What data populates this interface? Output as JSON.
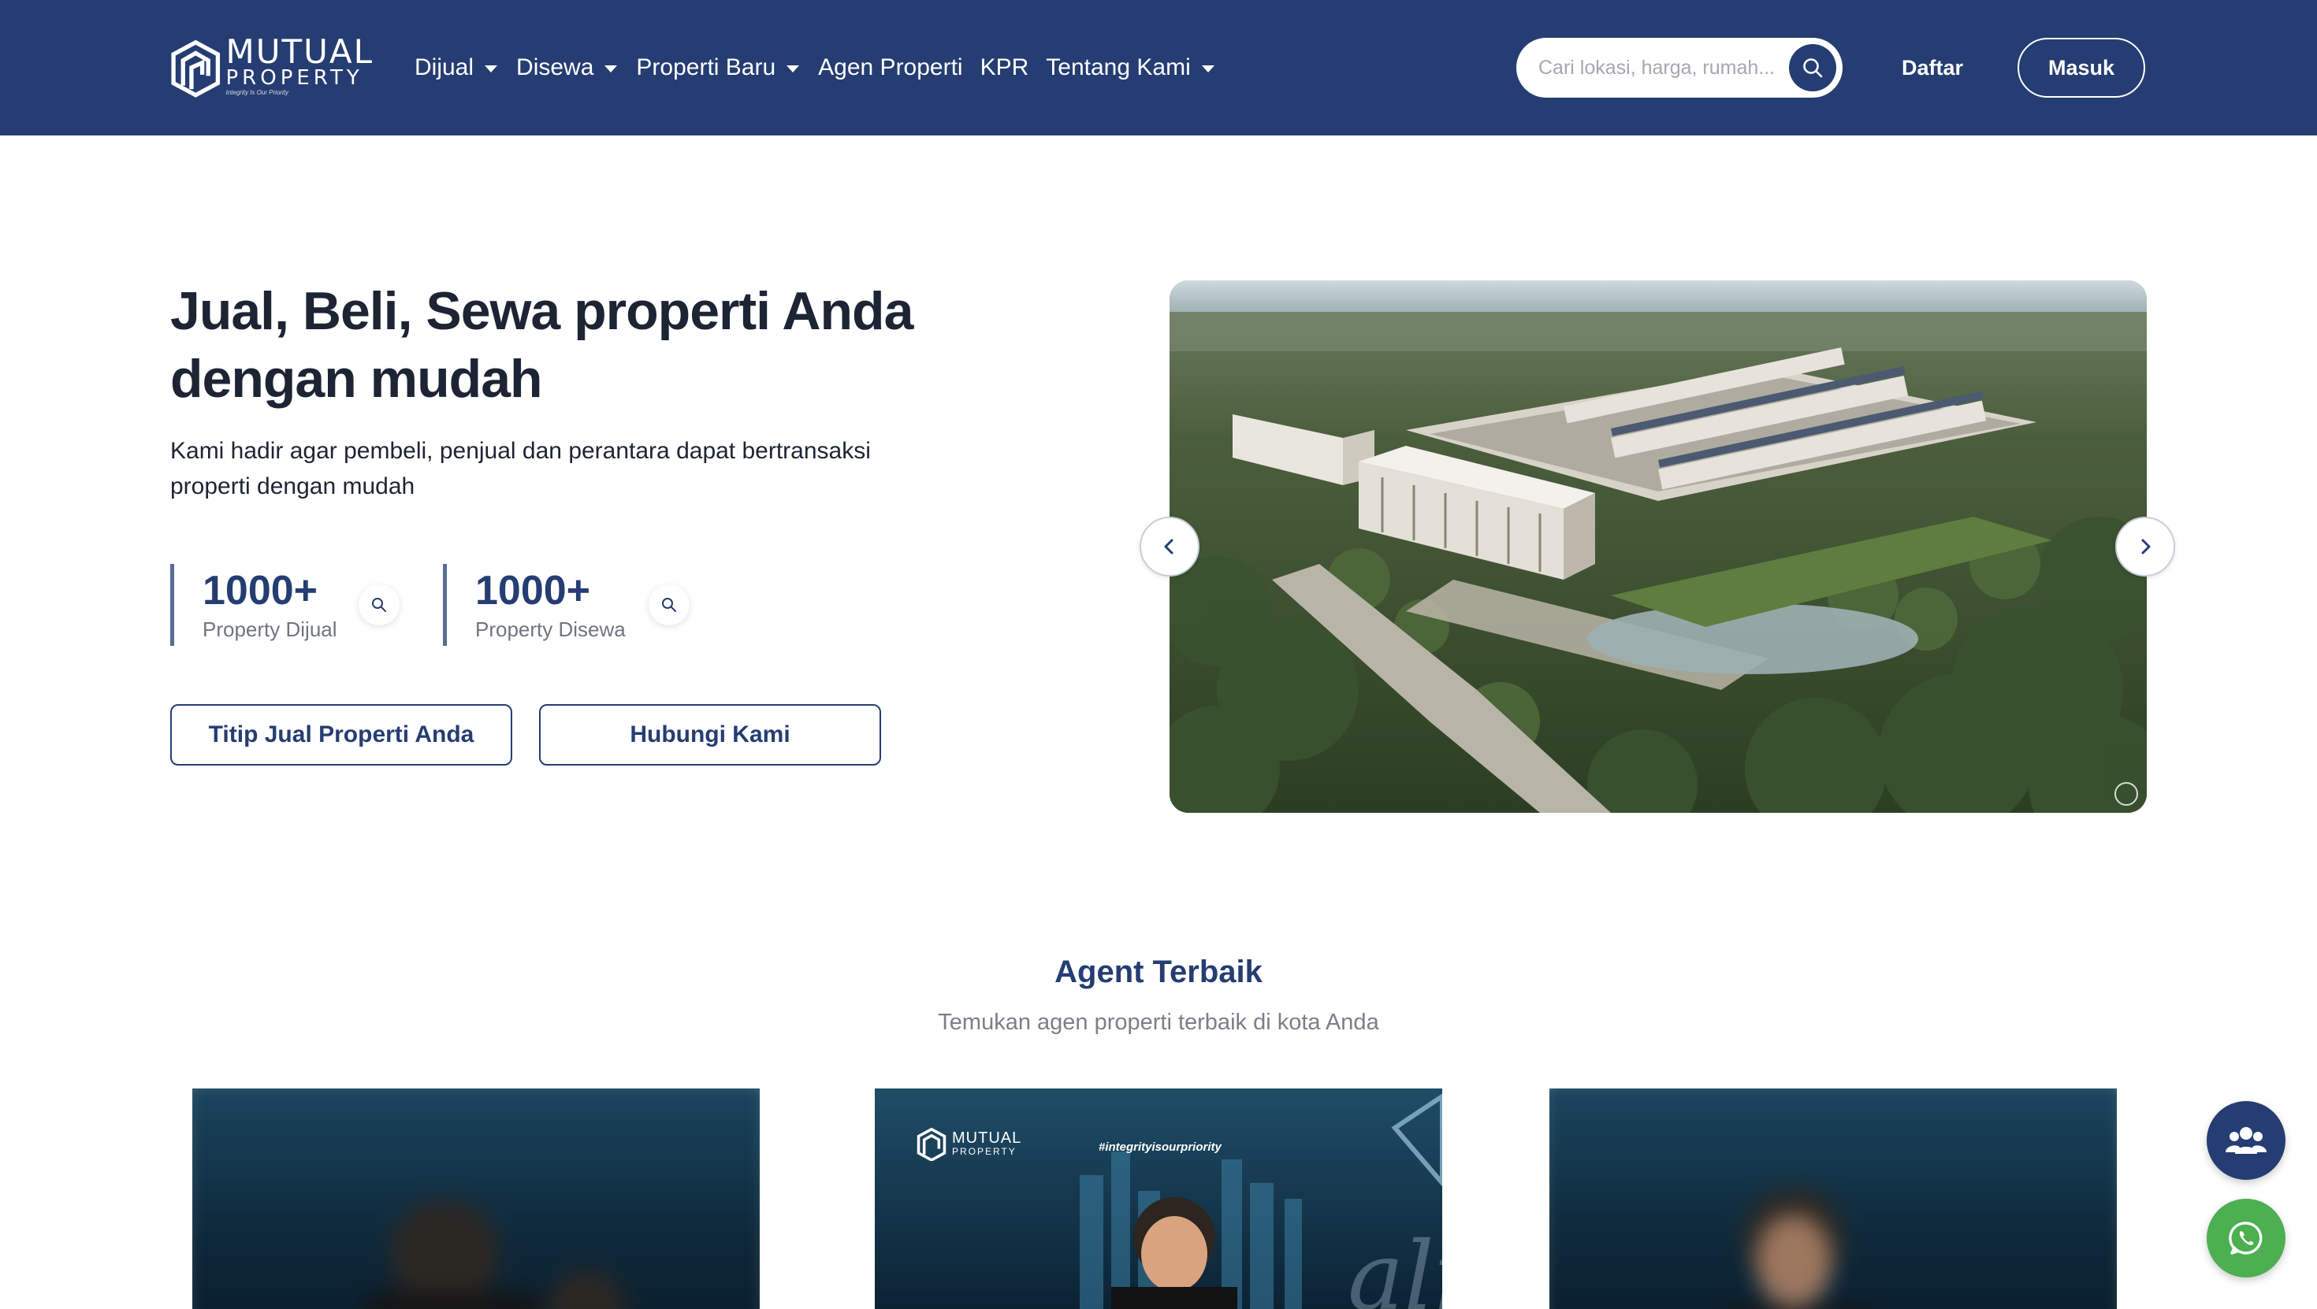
{
  "header": {
    "logo": {
      "name": "MUTUAL",
      "sub": "PROPERTY",
      "tagline": "Integrity Is Our Priority"
    },
    "nav": [
      {
        "label": "Dijual",
        "dropdown": true
      },
      {
        "label": "Disewa",
        "dropdown": true
      },
      {
        "label": "Properti Baru",
        "dropdown": true
      },
      {
        "label": "Agen Properti",
        "dropdown": false
      },
      {
        "label": "KPR",
        "dropdown": false
      },
      {
        "label": "Tentang Kami",
        "dropdown": true
      }
    ],
    "search_placeholder": "Cari lokasi, harga, rumah...",
    "daftar": "Daftar",
    "masuk": "Masuk"
  },
  "hero": {
    "title": "Jual, Beli, Sewa properti Anda dengan mudah",
    "subtitle": "Kami hadir agar pembeli, penjual dan perantara dapat bertransaksi properti dengan mudah",
    "stats": [
      {
        "value": "1000+",
        "label": "Property Dijual"
      },
      {
        "value": "1000+",
        "label": "Property Disewa"
      }
    ],
    "buttons": {
      "primary": "Titip Jual Properti Anda",
      "secondary": "Hubungi Kami"
    }
  },
  "agents": {
    "title": "Agent Terbaik",
    "subtitle": "Temukan agen properti terbaik di kota Anda",
    "card_logo": "MUTUAL",
    "card_logo_sub": "PROPERTY",
    "card_hashtag": "#integrityisourpriority"
  },
  "colors": {
    "primary": "#253d72",
    "whatsapp": "#4caf50",
    "white": "#ffffff"
  }
}
